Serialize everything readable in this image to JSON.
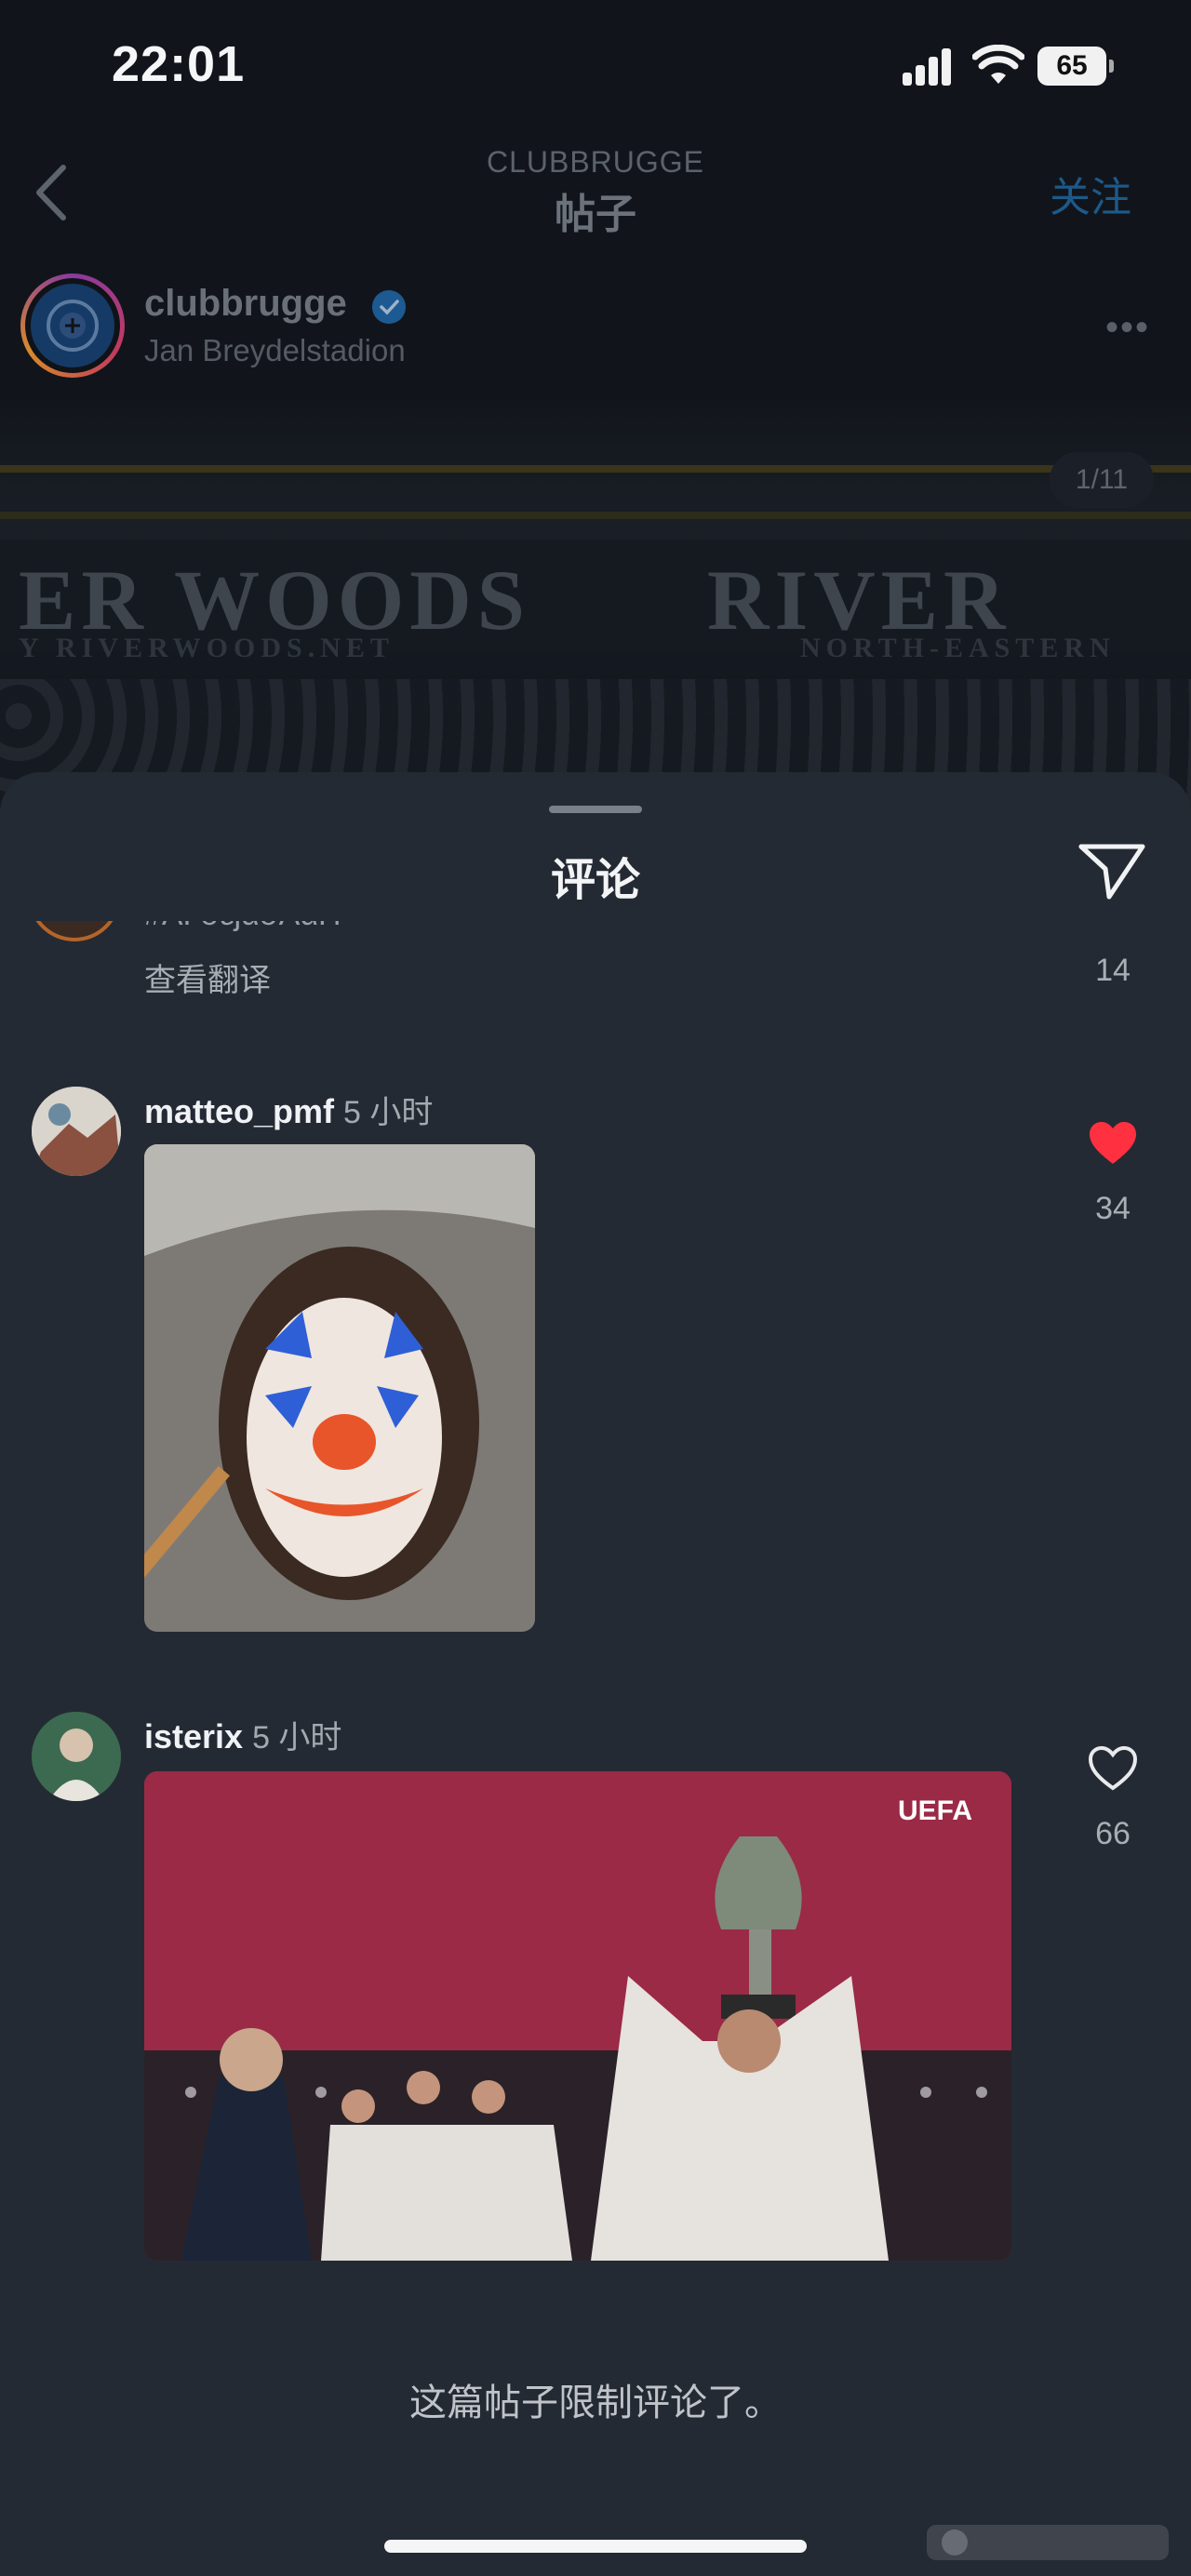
{
  "status_bar": {
    "time": "22:01",
    "battery": "65"
  },
  "header": {
    "subtitle": "CLUBBRUGGE",
    "title": "帖子",
    "follow_label": "关注"
  },
  "account": {
    "name": "clubbrugge",
    "location": "Jan Breydelstadion"
  },
  "photo": {
    "counter": "1/11",
    "banner_left": "ER WOODS",
    "banner_right": "RIVER",
    "banner_small_left": "Y RIVERWOODS.NET",
    "banner_small_right": "NORTH-EASTERN"
  },
  "sheet": {
    "title": "评论",
    "partial_comment": {
      "username_fragment": "#ΛΓσεjασΛαΠ",
      "translate_label": "查看翻译",
      "likes": "14"
    },
    "comments": [
      {
        "username": "matteo_pmf",
        "time": "5 小时",
        "likes": "34",
        "liked": true
      },
      {
        "username": "isterix",
        "time": "5 小时",
        "likes": "66",
        "liked": false,
        "gif_badge": "UEFA"
      }
    ],
    "restricted_notice": "这篇帖子限制评论了。"
  },
  "colors": {
    "like_red": "#ff3040",
    "sheet_bg": "#242a33",
    "follow_blue": "#1c5a8a"
  },
  "icons": [
    "back-chevron-icon",
    "verified-badge-icon",
    "more-options-icon",
    "share-send-icon",
    "heart-filled-icon",
    "heart-outline-icon"
  ]
}
